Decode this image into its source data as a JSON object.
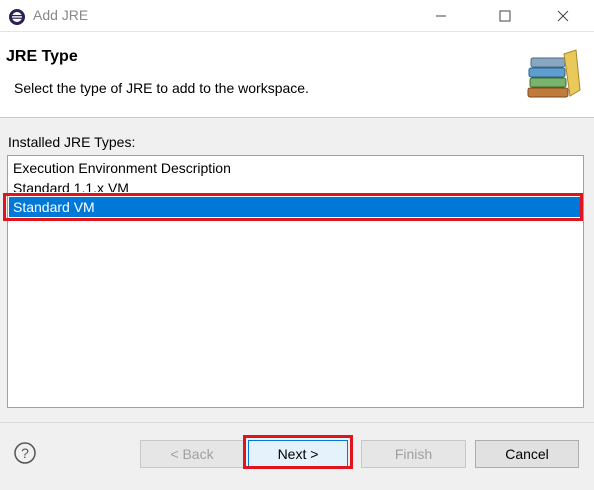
{
  "window": {
    "title": "Add JRE",
    "minimize_icon": "minimize-icon",
    "maximize_icon": "maximize-icon",
    "close_icon": "close-icon"
  },
  "header": {
    "title": "JRE Type",
    "description": "Select the type of JRE to add to the workspace.",
    "icon": "library-books-icon"
  },
  "list": {
    "label": "Installed JRE Types:",
    "items": [
      {
        "label": "Execution Environment Description",
        "selected": false
      },
      {
        "label": "Standard 1.1.x VM",
        "selected": false
      },
      {
        "label": "Standard VM",
        "selected": true
      }
    ]
  },
  "buttons": {
    "help_icon": "help-icon",
    "back": {
      "label": "< Back",
      "enabled": false
    },
    "next": {
      "label": "Next >",
      "enabled": true
    },
    "finish": {
      "label": "Finish",
      "enabled": false
    },
    "cancel": {
      "label": "Cancel",
      "enabled": true
    }
  },
  "colors": {
    "selection": "#0078d7",
    "highlight_box": "#e0141c"
  }
}
